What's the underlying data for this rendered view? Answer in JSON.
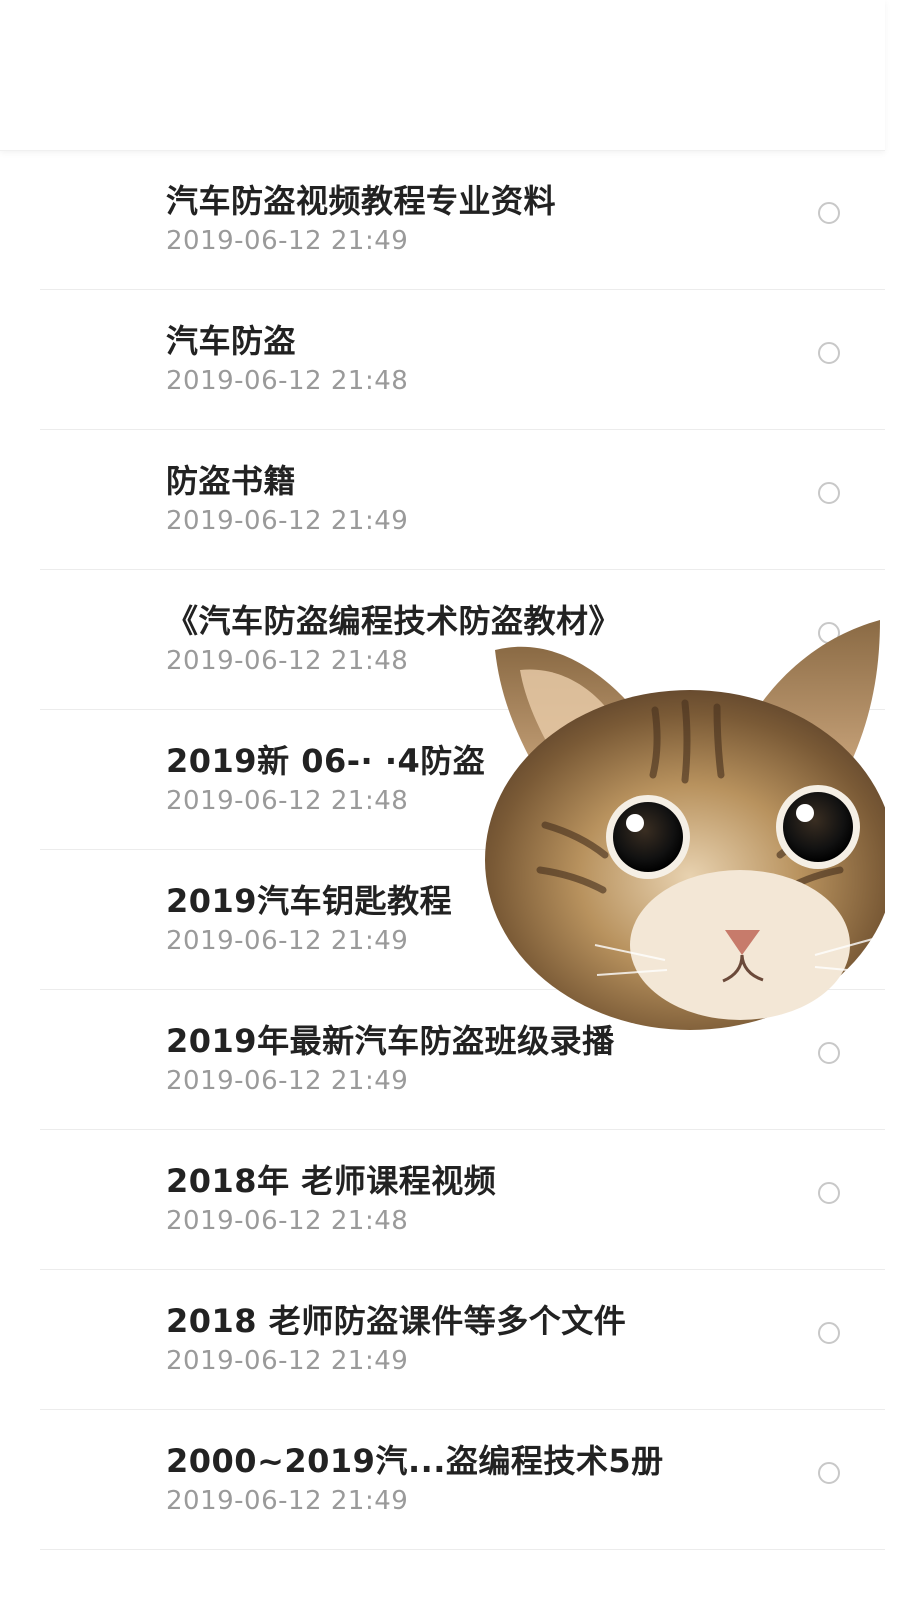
{
  "header": {
    "title": ""
  },
  "items": [
    {
      "title": "汽车防盗视频教程专业资料",
      "date": "2019-06-12 21:49"
    },
    {
      "title": "汽车防盗",
      "date": "2019-06-12 21:48"
    },
    {
      "title": "防盗书籍",
      "date": "2019-06-12 21:49"
    },
    {
      "title": "《汽车防盗编程技术防盗教材》",
      "date": "2019-06-12 21:48"
    },
    {
      "title": "2019新 06-· ·4防盗",
      "date": "2019-06-12 21:48"
    },
    {
      "title": "2019汽车钥匙教程",
      "date": "2019-06-12 21:49"
    },
    {
      "title": "2019年最新汽车防盗班级录播",
      "date": "2019-06-12 21:49"
    },
    {
      "title": "2018年 老师课程视频",
      "date": "2019-06-12 21:48"
    },
    {
      "title": "2018 老师防盗课件等多个文件",
      "date": "2019-06-12 21:49"
    },
    {
      "title": "2000~2019汽...盗编程技术5册",
      "date": "2019-06-12 21:49"
    }
  ],
  "overlay": {
    "icon": "cat-sticker-icon"
  }
}
